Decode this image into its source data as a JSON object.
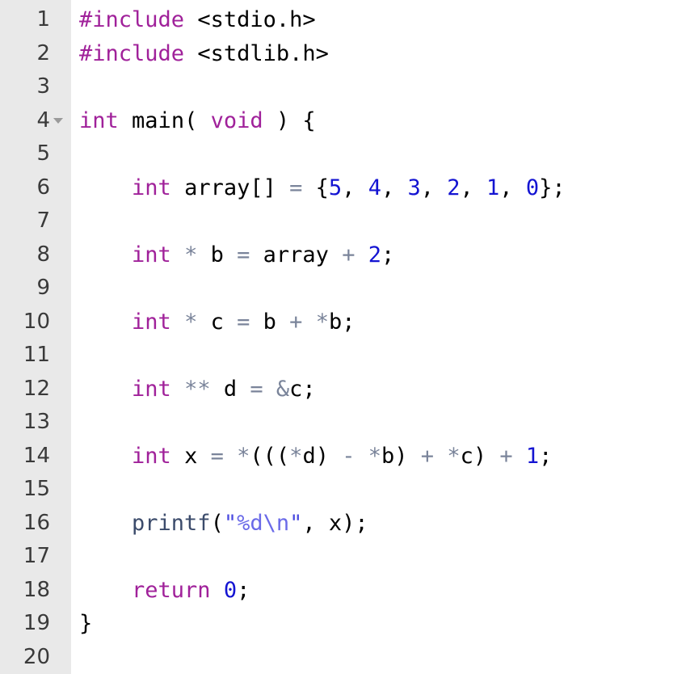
{
  "editor": {
    "language": "c",
    "total_lines": 20,
    "gutter_background": "#e9e9e9",
    "code_background": "#ffffff",
    "lineno_color": "#3a3a3a",
    "palette": {
      "keyword": "#a0219a",
      "number": "#1414d2",
      "operator": "#7a849a",
      "function": "#3b4b6b",
      "string": "#6a6ae8",
      "quote": "#4a4ae0",
      "plain": "#000000"
    },
    "fold_markers": [
      {
        "line": 4,
        "icon": "chevron-down-icon",
        "state": "expanded"
      }
    ],
    "lines": [
      {
        "number": "1",
        "fold": false,
        "text": "#include <stdio.h>",
        "tokens": [
          {
            "t": "#include",
            "k": "keyword"
          },
          {
            "t": " ",
            "k": "plain"
          },
          {
            "t": "<stdio.h>",
            "k": "plain"
          }
        ]
      },
      {
        "number": "2",
        "fold": false,
        "text": "#include <stdlib.h>",
        "tokens": [
          {
            "t": "#include",
            "k": "keyword"
          },
          {
            "t": " ",
            "k": "plain"
          },
          {
            "t": "<stdlib.h>",
            "k": "plain"
          }
        ]
      },
      {
        "number": "3",
        "fold": false,
        "text": "",
        "tokens": []
      },
      {
        "number": "4",
        "fold": true,
        "text": "int main( void ) {",
        "tokens": [
          {
            "t": "int",
            "k": "keyword"
          },
          {
            "t": " ",
            "k": "plain"
          },
          {
            "t": "main",
            "k": "plain"
          },
          {
            "t": "( ",
            "k": "punct"
          },
          {
            "t": "void",
            "k": "keyword"
          },
          {
            "t": " ) {",
            "k": "punct"
          }
        ]
      },
      {
        "number": "5",
        "fold": false,
        "text": "",
        "tokens": []
      },
      {
        "number": "6",
        "fold": false,
        "text": "    int array[] = {5, 4, 3, 2, 1, 0};",
        "tokens": [
          {
            "t": "    ",
            "k": "plain"
          },
          {
            "t": "int",
            "k": "keyword"
          },
          {
            "t": " ",
            "k": "plain"
          },
          {
            "t": "array[] ",
            "k": "plain"
          },
          {
            "t": "=",
            "k": "operator"
          },
          {
            "t": " {",
            "k": "punct"
          },
          {
            "t": "5",
            "k": "number"
          },
          {
            "t": ", ",
            "k": "punct"
          },
          {
            "t": "4",
            "k": "number"
          },
          {
            "t": ", ",
            "k": "punct"
          },
          {
            "t": "3",
            "k": "number"
          },
          {
            "t": ", ",
            "k": "punct"
          },
          {
            "t": "2",
            "k": "number"
          },
          {
            "t": ", ",
            "k": "punct"
          },
          {
            "t": "1",
            "k": "number"
          },
          {
            "t": ", ",
            "k": "punct"
          },
          {
            "t": "0",
            "k": "number"
          },
          {
            "t": "};",
            "k": "punct"
          }
        ]
      },
      {
        "number": "7",
        "fold": false,
        "text": "",
        "tokens": []
      },
      {
        "number": "8",
        "fold": false,
        "text": "    int * b = array + 2;",
        "tokens": [
          {
            "t": "    ",
            "k": "plain"
          },
          {
            "t": "int",
            "k": "keyword"
          },
          {
            "t": " ",
            "k": "plain"
          },
          {
            "t": "*",
            "k": "operator"
          },
          {
            "t": " b ",
            "k": "plain"
          },
          {
            "t": "=",
            "k": "operator"
          },
          {
            "t": " array ",
            "k": "plain"
          },
          {
            "t": "+",
            "k": "operator"
          },
          {
            "t": " ",
            "k": "plain"
          },
          {
            "t": "2",
            "k": "number"
          },
          {
            "t": ";",
            "k": "punct"
          }
        ]
      },
      {
        "number": "9",
        "fold": false,
        "text": "",
        "tokens": []
      },
      {
        "number": "10",
        "fold": false,
        "text": "    int * c = b + *b;",
        "tokens": [
          {
            "t": "    ",
            "k": "plain"
          },
          {
            "t": "int",
            "k": "keyword"
          },
          {
            "t": " ",
            "k": "plain"
          },
          {
            "t": "*",
            "k": "operator"
          },
          {
            "t": " c ",
            "k": "plain"
          },
          {
            "t": "=",
            "k": "operator"
          },
          {
            "t": " b ",
            "k": "plain"
          },
          {
            "t": "+",
            "k": "operator"
          },
          {
            "t": " ",
            "k": "plain"
          },
          {
            "t": "*",
            "k": "operator"
          },
          {
            "t": "b;",
            "k": "punct"
          }
        ]
      },
      {
        "number": "11",
        "fold": false,
        "text": "",
        "tokens": []
      },
      {
        "number": "12",
        "fold": false,
        "text": "    int ** d = &c;",
        "tokens": [
          {
            "t": "    ",
            "k": "plain"
          },
          {
            "t": "int",
            "k": "keyword"
          },
          {
            "t": " ",
            "k": "plain"
          },
          {
            "t": "**",
            "k": "operator"
          },
          {
            "t": " d ",
            "k": "plain"
          },
          {
            "t": "=",
            "k": "operator"
          },
          {
            "t": " ",
            "k": "plain"
          },
          {
            "t": "&",
            "k": "operator"
          },
          {
            "t": "c;",
            "k": "punct"
          }
        ]
      },
      {
        "number": "13",
        "fold": false,
        "text": "",
        "tokens": []
      },
      {
        "number": "14",
        "fold": false,
        "text": "    int x = *(((*d) - *b) + *c) + 1;",
        "tokens": [
          {
            "t": "    ",
            "k": "plain"
          },
          {
            "t": "int",
            "k": "keyword"
          },
          {
            "t": " x ",
            "k": "plain"
          },
          {
            "t": "=",
            "k": "operator"
          },
          {
            "t": " ",
            "k": "plain"
          },
          {
            "t": "*",
            "k": "operator"
          },
          {
            "t": "(((",
            "k": "punct"
          },
          {
            "t": "*",
            "k": "operator"
          },
          {
            "t": "d) ",
            "k": "punct"
          },
          {
            "t": "-",
            "k": "operator"
          },
          {
            "t": " ",
            "k": "plain"
          },
          {
            "t": "*",
            "k": "operator"
          },
          {
            "t": "b) ",
            "k": "punct"
          },
          {
            "t": "+",
            "k": "operator"
          },
          {
            "t": " ",
            "k": "plain"
          },
          {
            "t": "*",
            "k": "operator"
          },
          {
            "t": "c) ",
            "k": "punct"
          },
          {
            "t": "+",
            "k": "operator"
          },
          {
            "t": " ",
            "k": "plain"
          },
          {
            "t": "1",
            "k": "number"
          },
          {
            "t": ";",
            "k": "punct"
          }
        ]
      },
      {
        "number": "15",
        "fold": false,
        "text": "",
        "tokens": []
      },
      {
        "number": "16",
        "fold": false,
        "text": "    printf(\"%d\\n\", x);",
        "tokens": [
          {
            "t": "    ",
            "k": "plain"
          },
          {
            "t": "printf",
            "k": "func"
          },
          {
            "t": "(",
            "k": "punct"
          },
          {
            "t": "\"",
            "k": "quote"
          },
          {
            "t": "%d\\n",
            "k": "string"
          },
          {
            "t": "\"",
            "k": "quote"
          },
          {
            "t": ", x);",
            "k": "punct"
          }
        ]
      },
      {
        "number": "17",
        "fold": false,
        "text": "",
        "tokens": []
      },
      {
        "number": "18",
        "fold": false,
        "text": "    return 0;",
        "tokens": [
          {
            "t": "    ",
            "k": "plain"
          },
          {
            "t": "return",
            "k": "keyword"
          },
          {
            "t": " ",
            "k": "plain"
          },
          {
            "t": "0",
            "k": "number"
          },
          {
            "t": ";",
            "k": "punct"
          }
        ]
      },
      {
        "number": "19",
        "fold": false,
        "text": "}",
        "tokens": [
          {
            "t": "}",
            "k": "punct"
          }
        ]
      },
      {
        "number": "20",
        "fold": false,
        "text": "",
        "tokens": []
      }
    ]
  }
}
